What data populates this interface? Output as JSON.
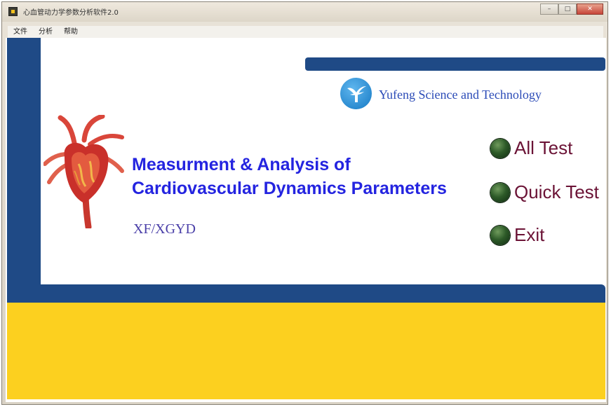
{
  "window": {
    "title": "心血管动力学参数分析软件2.0"
  },
  "menubar": {
    "items": [
      "文件",
      "分析",
      "帮助"
    ]
  },
  "branding": {
    "company": "Yufeng Science and Technology",
    "logo_icon": "yufeng-logo-icon"
  },
  "main": {
    "title_line1": "Measurment & Analysis of",
    "title_line2": "Cardiovascular Dynamics Parameters",
    "subtitle": "XF/XGYD",
    "illustration_icon": "heart-illustration-icon"
  },
  "actions": {
    "all_test": "All Test",
    "quick_test": "Quick Test",
    "exit": "Exit"
  },
  "colors": {
    "navy_bar": "#1f4a86",
    "yellow_panel": "#fcd01f",
    "title_blue": "#2424e0",
    "button_text": "#6b1336",
    "led_green": "#2d5a28"
  }
}
